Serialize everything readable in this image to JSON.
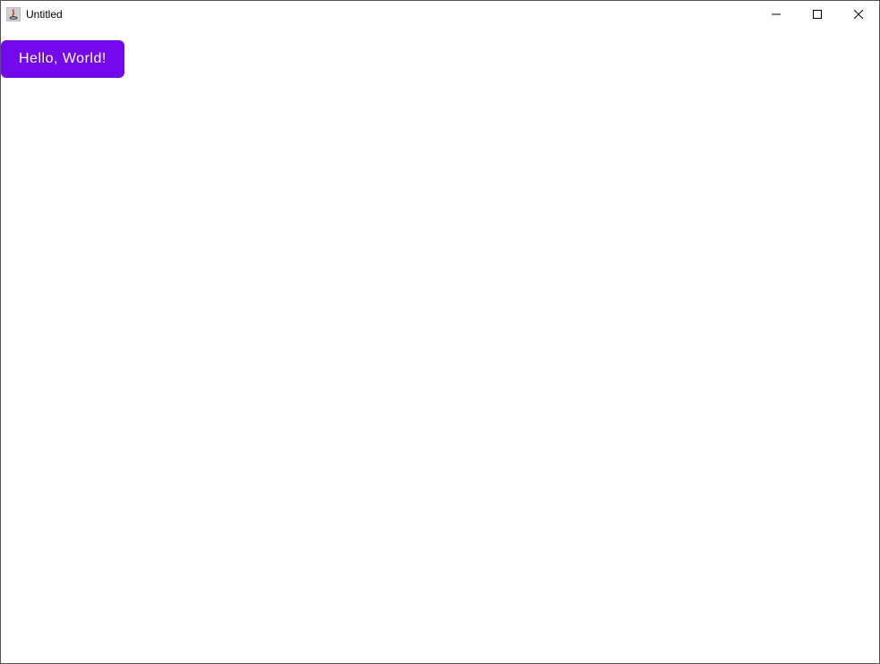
{
  "window": {
    "title": "Untitled"
  },
  "content": {
    "button_label": "Hello, World!"
  }
}
